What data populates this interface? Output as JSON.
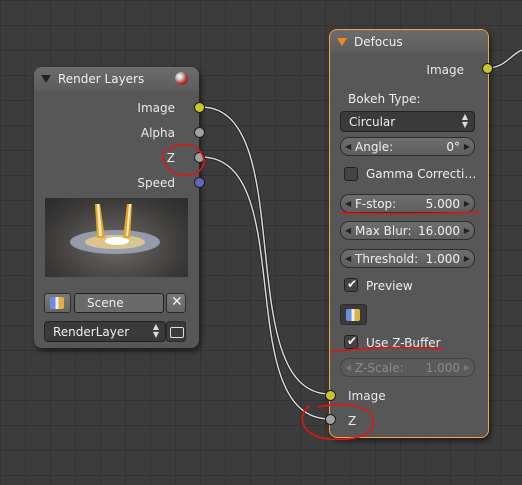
{
  "render_layers": {
    "title": "Render Layers",
    "outputs": [
      "Image",
      "Alpha",
      "Z",
      "Speed"
    ],
    "scene_name": "Scene",
    "layer_name": "RenderLayer"
  },
  "defocus": {
    "title": "Defocus",
    "output": "Image",
    "bokeh_label": "Bokeh Type:",
    "bokeh_value": "Circular",
    "angle": {
      "label": "Angle:",
      "value": "0°"
    },
    "gamma": {
      "label": "Gamma Correcti…",
      "checked": false
    },
    "fstop": {
      "label": "F-stop:",
      "value": "5.000"
    },
    "maxblur": {
      "label": "Max Blur:",
      "value": "16.000"
    },
    "threshold": {
      "label": "Threshold:",
      "value": "1.000"
    },
    "preview": {
      "label": "Preview",
      "checked": true
    },
    "use_zbuffer": {
      "label": "Use Z-Buffer",
      "checked": true
    },
    "zscale": {
      "label": "Z-Scale:",
      "value": "1.000"
    },
    "inputs": [
      "Image",
      "Z"
    ]
  },
  "colors": {
    "image_socket": "#c7c729",
    "value_socket": "#a1a1a1",
    "vector_socket": "#6363c7",
    "selected_outline": "#f3a444",
    "annotation_red": "#e01515"
  }
}
